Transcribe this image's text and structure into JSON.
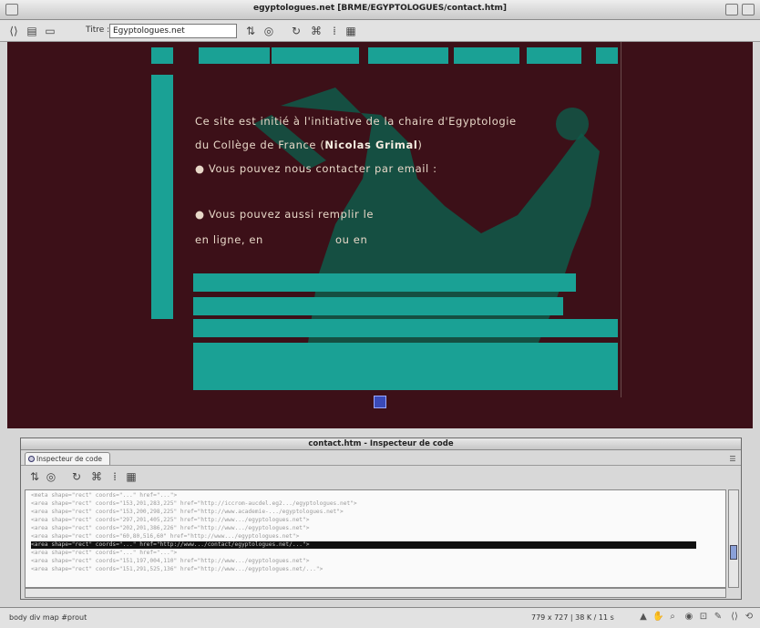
{
  "window": {
    "title": "egyptologues.net [BRME/EGYPTOLOGUES/contact.htm]"
  },
  "toolbar": {
    "title_label": "Titre :",
    "title_value": "Egyptologues.net"
  },
  "page": {
    "nav": [
      "",
      "",
      "",
      "",
      "",
      "",
      ""
    ],
    "line1": "Ce site est initié à l'initiative de la chaire d'Egyptologie",
    "line2_pre": "du Collège de France (",
    "line2_name": "Nicolas Grimal",
    "line2_post": ")",
    "line3": "● Vous pouvez nous contacter par email :",
    "line5_pre": "● Vous pouvez aussi remplir le",
    "line6_pre": "en ligne, en",
    "line6_mid": "ou en"
  },
  "inspector": {
    "title": "contact.htm - Inspecteur de code",
    "tab_label": "Inspecteur de code",
    "code_lines": [
      "<meta shape=\"rect\" coords=\"...\" href=\"...\">",
      "<area shape=\"rect\" coords=\"153,201,283,225\" href=\"http://iccrom-aucdel.eg2.../egyptologues.net\">",
      "<area shape=\"rect\" coords=\"153,200,298,225\" href=\"http://www.academie-.../egyptologues.net\">",
      "<area shape=\"rect\" coords=\"297,201,405,225\" href=\"http://www.../egyptologues.net\">",
      "<area shape=\"rect\" coords=\"202,201,386,226\" href=\"http://www.../egyptologues.net\">",
      "<area shape=\"rect\" coords=\"60,80,516,60\" href=\"http://www.../egyptologues.net\">",
      "<area shape=\"rect\" coords=\"...\" href=\"http://www.../contact/egyptologues.net/...\">",
      "<area shape=\"rect\" coords=\"...\" href=\"...\">",
      "<area shape=\"rect\" coords=\"151,197,004,110\" href=\"http://www.../egyptologues.net\">",
      "<area shape=\"rect\" coords=\"151,291,525,136\" href=\"http://www.../egyptologues.net/...\">"
    ]
  },
  "status": {
    "left": "body  div  map  #prout",
    "right": "779 x 727  |  38 K / 11 s"
  }
}
